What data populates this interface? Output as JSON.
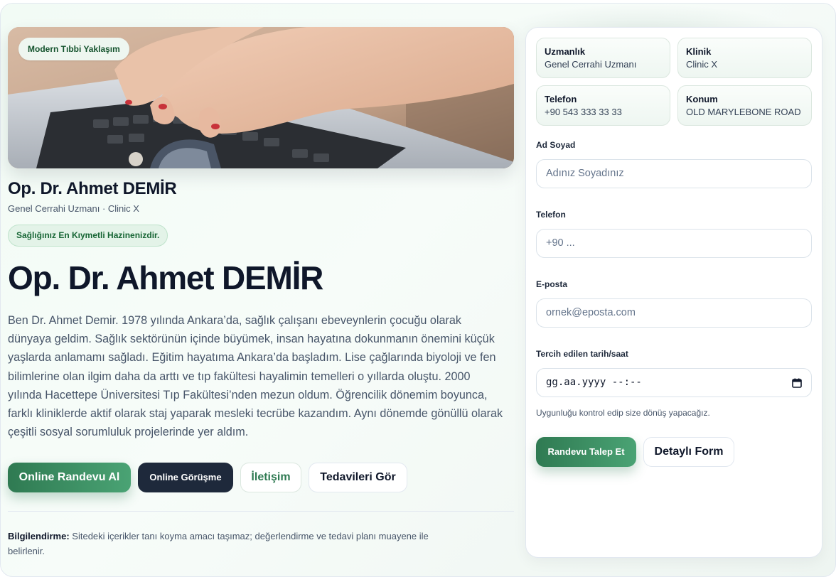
{
  "hero": {
    "badge": "Modern Tıbbi Yaklaşım"
  },
  "doctor": {
    "name": "Op. Dr. Ahmet DEMİR",
    "subtitle": "Genel Cerrahi Uzmanı · Clinic X",
    "motto": "Sağlığınız En Kıymetli Hazinenizdir.",
    "bio": "Ben Dr. Ahmet Demir. 1978 yılında Ankara’da, sağlık çalışanı ebeveynlerin çocuğu olarak dünyaya geldim. Sağlık sektörünün içinde büyümek, insan hayatına dokunmanın önemini küçük yaşlarda anlamamı sağladı. Eğitim hayatıma Ankara’da başladım. Lise çağlarında biyoloji ve fen bilimlerine olan ilgim daha da arttı ve tıp fakültesi hayalimin temelleri o yıllarda oluştu. 2000 yılında Hacettepe Üniversitesi Tıp Fakültesi’nden mezun oldum. Öğrencilik dönemim boyunca, farklı kliniklerde aktif olarak staj yaparak mesleki tecrübe kazandım. Aynı dönemde gönüllü olarak çeşitli sosyal sorumluluk projelerinde yer aldım."
  },
  "actions": {
    "online_appointment": "Online Randevu Al",
    "online_meeting": "Online Görüşme",
    "contact": "İletişim",
    "treatments": "Tedavileri Gör"
  },
  "notice": {
    "label": "Bilgilendirme:",
    "text": " Sitedeki içerikler tanı koyma amacı taşımaz; değerlendirme ve tedavi planı muayene ile belirlenir."
  },
  "info_cards": [
    {
      "key": "Uzmanlık",
      "value": "Genel Cerrahi Uzmanı"
    },
    {
      "key": "Klinik",
      "value": "Clinic X"
    },
    {
      "key": "Telefon",
      "value": "+90 543 333 33 33"
    },
    {
      "key": "Konum",
      "value": "OLD MARYLEBONE ROAD"
    }
  ],
  "form": {
    "name_label": "Ad Soyad",
    "name_placeholder": "Adınız Soyadınız",
    "phone_label": "Telefon",
    "phone_placeholder": "+90 ...",
    "email_label": "E-posta",
    "email_placeholder": "ornek@eposta.com",
    "datetime_label": "Tercih edilen tarih/saat",
    "datetime_value": "gg.aa.yyyy --:--",
    "hint": "Uygunluğu kontrol edip size dönüş yapacağız.",
    "submit": "Randevu Talep Et",
    "detailed": "Detaylı Form"
  }
}
